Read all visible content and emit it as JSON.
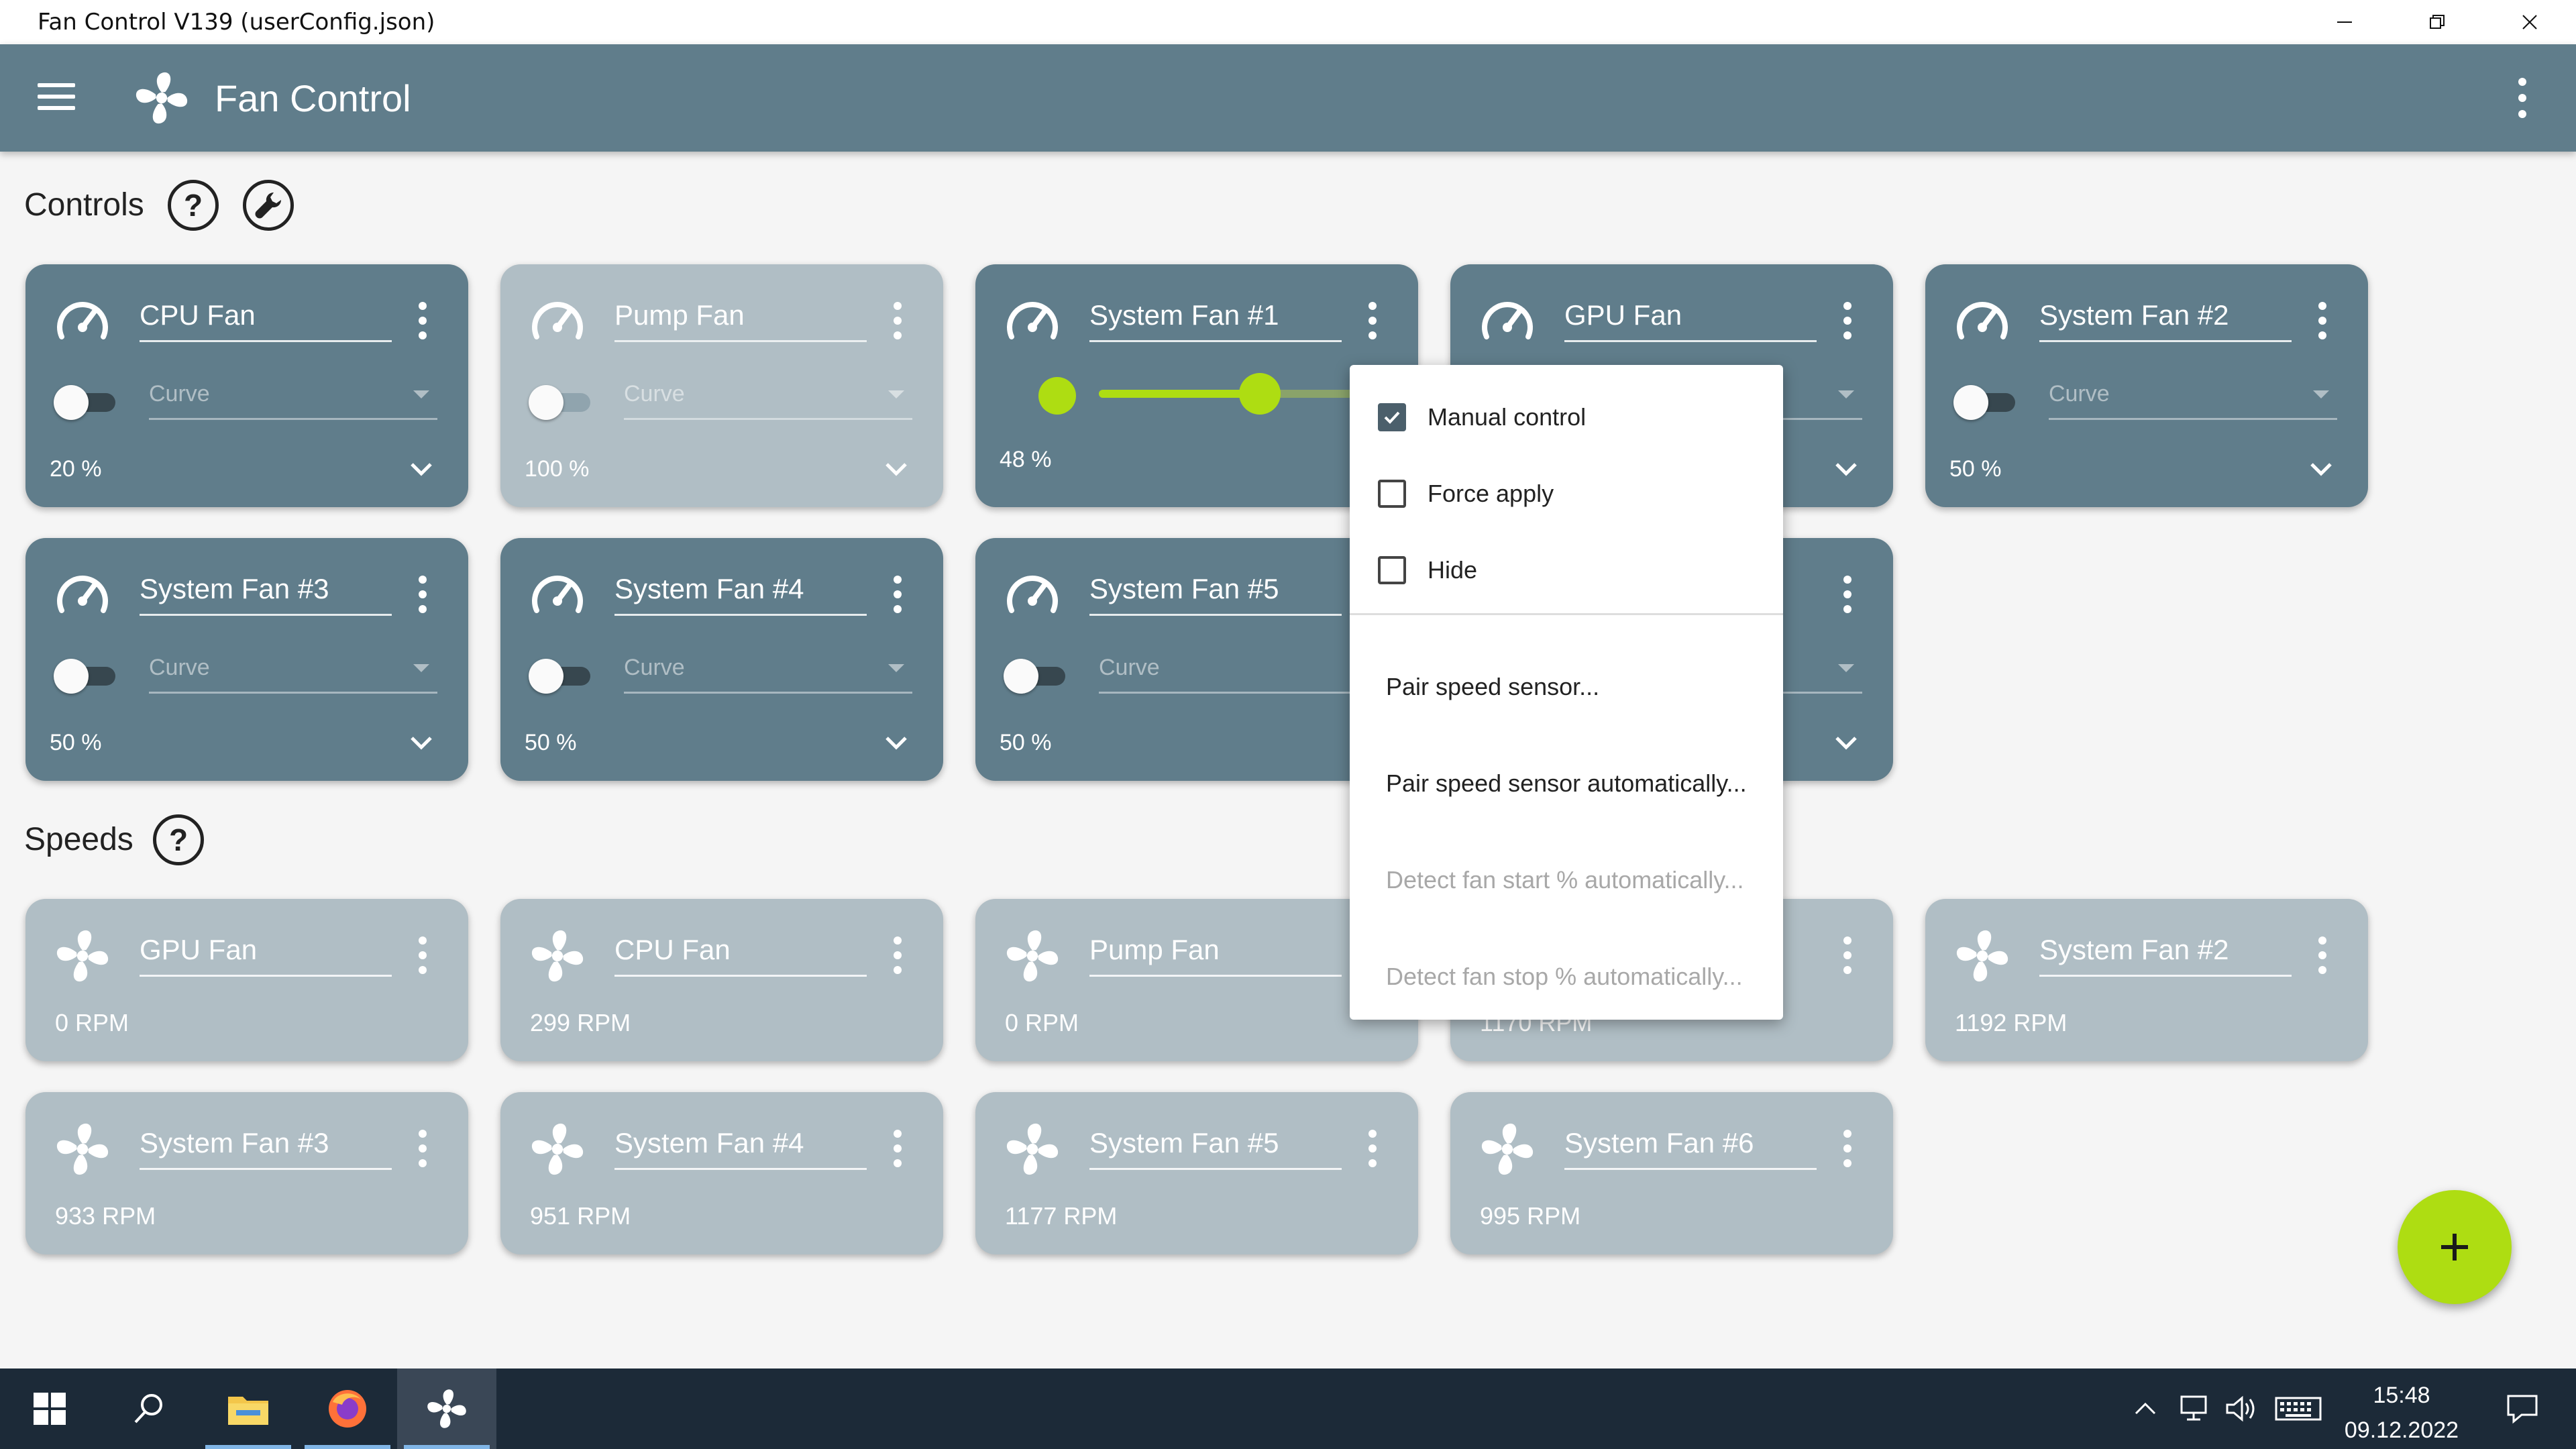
{
  "window": {
    "title": "Fan Control V139 (userConfig.json)",
    "minimize": "–",
    "restore": "❐",
    "close": "✕"
  },
  "appbar": {
    "title": "Fan Control"
  },
  "controls_section": {
    "title": "Controls",
    "help": "?",
    "cards": [
      {
        "name": "CPU Fan",
        "mode": "Curve",
        "value": "20 %"
      },
      {
        "name": "Pump Fan",
        "mode": "Curve",
        "value": "100 %"
      },
      {
        "name": "System Fan #1",
        "value": "48 %",
        "slider_fraction": 0.48
      },
      {
        "name": "GPU Fan",
        "value": ""
      },
      {
        "name": "System Fan #2",
        "mode": "Curve",
        "value": "50 %"
      },
      {
        "name": "System Fan #3",
        "mode": "Curve",
        "value": "50 %"
      },
      {
        "name": "System Fan #4",
        "mode": "Curve",
        "value": "50 %"
      },
      {
        "name": "System Fan #5",
        "mode": "Curve",
        "value": "50 %"
      }
    ]
  },
  "speeds_section": {
    "title": "Speeds",
    "help": "?",
    "cards": [
      {
        "name": "GPU Fan",
        "value": "0 RPM"
      },
      {
        "name": "CPU Fan",
        "value": "299 RPM"
      },
      {
        "name": "Pump Fan",
        "value": "0 RPM"
      },
      {
        "name": "",
        "value": "1170 RPM"
      },
      {
        "name": "System Fan #2",
        "value": "1192 RPM"
      },
      {
        "name": "System Fan #3",
        "value": "933 RPM"
      },
      {
        "name": "System Fan #4",
        "value": "951 RPM"
      },
      {
        "name": "System Fan #5",
        "value": "1177 RPM"
      },
      {
        "name": "System Fan #6",
        "value": "995 RPM"
      }
    ]
  },
  "context_menu": {
    "manual_control": {
      "label": "Manual control",
      "checked": true
    },
    "force_apply": {
      "label": "Force apply",
      "checked": false
    },
    "hide": {
      "label": "Hide",
      "checked": false
    },
    "pair_speed_sensor": "Pair speed sensor...",
    "pair_speed_sensor_auto": "Pair speed sensor automatically...",
    "detect_fan_start": "Detect fan start % automatically...",
    "detect_fan_stop": "Detect fan stop % automatically..."
  },
  "taskbar": {
    "time": "15:48",
    "date": "09.12.2022"
  },
  "colors": {
    "appbar": "#607d8b",
    "card_active": "#607d8b",
    "card_inactive": "#b0bec5",
    "accent": "#aedd12",
    "taskbar": "#1c2a38"
  }
}
